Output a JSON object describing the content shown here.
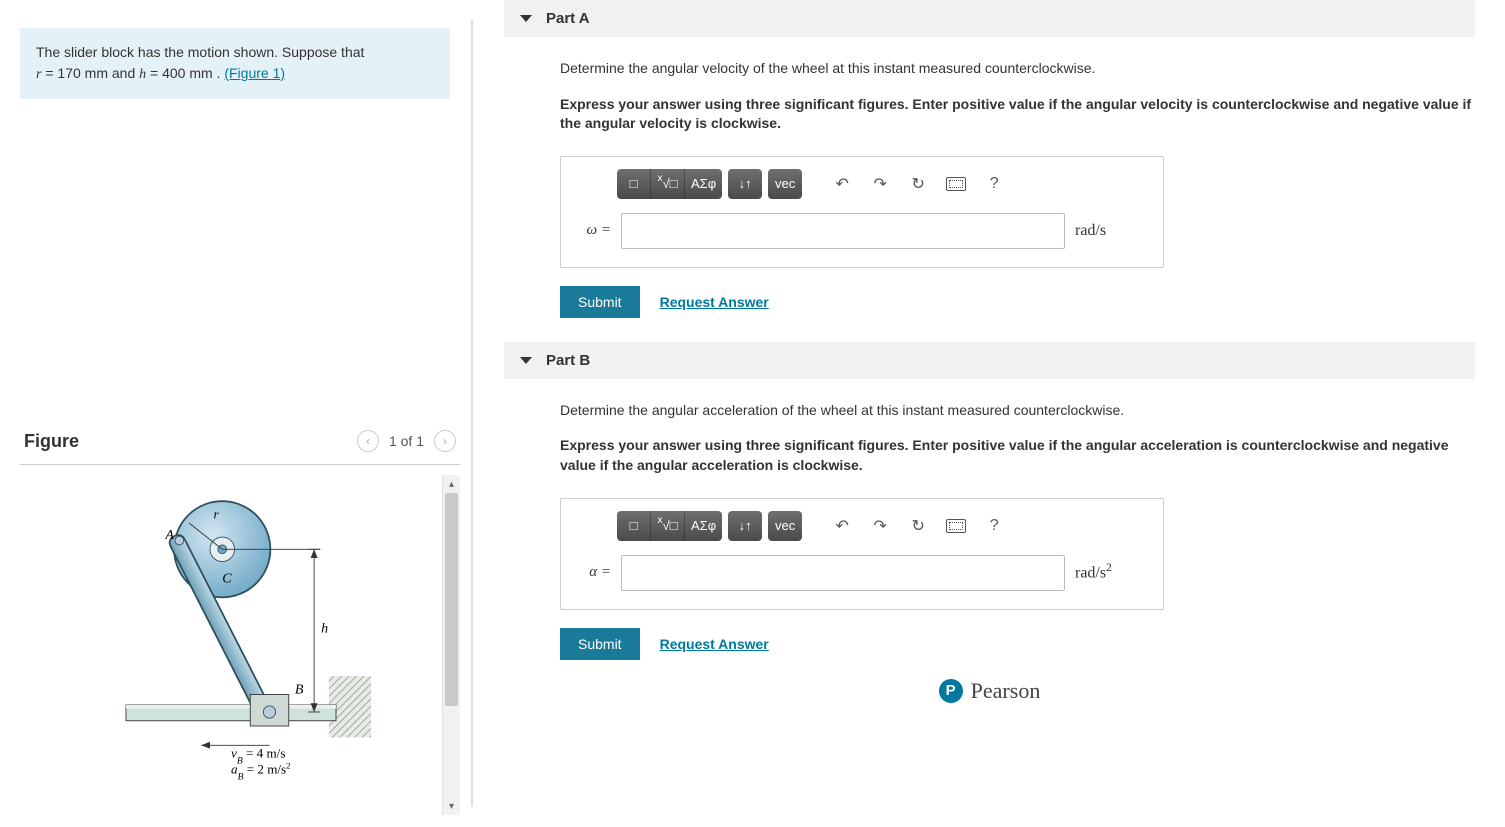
{
  "problem": {
    "text1": "The slider block has the motion shown. Suppose that",
    "r_var": "r",
    "r_eq": " = 170  mm and ",
    "h_var": "h",
    "h_eq": " = 400  mm . ",
    "figure_link": "(Figure 1)"
  },
  "figure": {
    "title": "Figure",
    "page_indicator": "1 of 1",
    "labels": {
      "A": "A",
      "C": "C",
      "B": "B",
      "r": "r",
      "h": "h"
    },
    "given": {
      "vB_sym": "v",
      "vB_sub": "B",
      "vB_rhs": " = 4 m/s",
      "aB_sym": "a",
      "aB_sub": "B",
      "aB_rhs": " = 2 m/s",
      "aB_sup": "2"
    }
  },
  "toolbar": {
    "template": "□",
    "frac_root": "√□",
    "greek": "ΑΣφ",
    "subsup": "↓↑",
    "vec": "vec",
    "undo": "↶",
    "redo": "↷",
    "reset": "↻",
    "help": "?"
  },
  "partA": {
    "title": "Part A",
    "prompt1": "Determine the angular velocity of the wheel at this instant measured counterclockwise.",
    "prompt2": "Express your answer using three significant figures. Enter positive value if the angular velocity is counterclockwise and negative value if the angular velocity is clockwise.",
    "lhs": "ω =",
    "units": "rad/s",
    "submit": "Submit",
    "request": "Request Answer"
  },
  "partB": {
    "title": "Part B",
    "prompt1": "Determine the angular acceleration of the wheel at this instant measured counterclockwise.",
    "prompt2": "Express your answer using three significant figures. Enter positive value if the angular acceleration is counterclockwise and negative value if the angular acceleration is clockwise.",
    "lhs": "α =",
    "units_base": "rad/s",
    "units_sup": "2",
    "submit": "Submit",
    "request": "Request Answer"
  },
  "footer": {
    "brand": "Pearson",
    "badge": "P"
  }
}
